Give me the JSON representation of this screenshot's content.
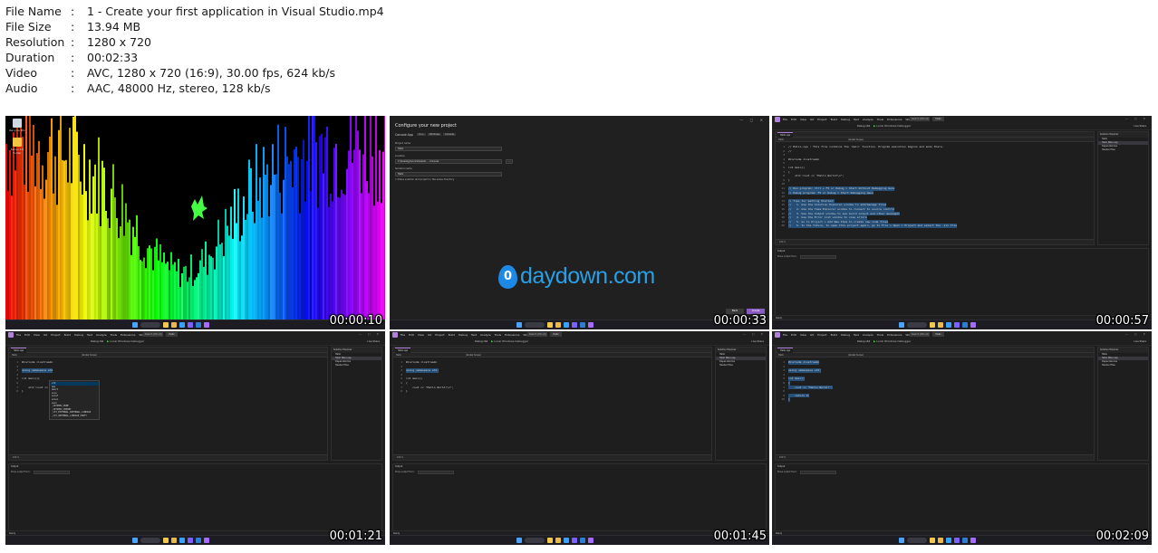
{
  "info": {
    "rows": [
      {
        "label": "File Name",
        "sep": ":",
        "value": "1 - Create your first application in Visual Studio.mp4"
      },
      {
        "label": "File Size",
        "sep": ":",
        "value": "13.94 MB"
      },
      {
        "label": "Resolution",
        "sep": ":",
        "value": "1280 x 720"
      },
      {
        "label": "Duration",
        "sep": ":",
        "value": "00:02:33"
      },
      {
        "label": "Video",
        "sep": ":",
        "value": "AVC, 1280 x 720 (16:9), 30.00 fps, 624 kb/s"
      },
      {
        "label": "Audio",
        "sep": ":",
        "value": "AAC, 48000 Hz, stereo, 128 kb/s"
      }
    ]
  },
  "thumbnails": [
    {
      "timestamp": "00:00:10",
      "desktop": {
        "icons": [
          {
            "label": "Recycle Bin",
            "icon": "recycle-bin-icon"
          },
          {
            "label": "Setup 1.0 Folder",
            "icon": "folder-icon"
          }
        ]
      }
    },
    {
      "timestamp": "00:00:33",
      "dialog": {
        "title": "Configure your new project",
        "project_type": "Console App",
        "tags": [
          "C++",
          "Windows",
          "Console"
        ],
        "fields": [
          {
            "label": "Project name",
            "value": "Hello"
          },
          {
            "label": "Location",
            "value": "C:\\Users\\jy\\source\\repos\\ ... Console"
          },
          {
            "label": "Solution name",
            "value": "Hello"
          }
        ],
        "checkbox": "Place solution and project in the same directory",
        "buttons": {
          "back": "Back",
          "create": "Create"
        },
        "watermark": {
          "badge": "0",
          "text": "daydown.com"
        }
      }
    },
    {
      "timestamp": "00:00:57",
      "ide": {
        "tab": "Hello.cpp",
        "code": [
          {
            "text": "// Hello.cpp : This file contains the 'main' function. Program execution begins and ends there.",
            "highlight": false
          },
          {
            "text": "//",
            "highlight": false
          },
          {
            "text": "",
            "highlight": false
          },
          {
            "text": "#include <iostream>",
            "highlight": false
          },
          {
            "text": "",
            "highlight": false
          },
          {
            "text": "int main()",
            "highlight": false
          },
          {
            "text": "{",
            "highlight": false
          },
          {
            "text": "    std::cout << \"Hello World!\\n\";",
            "highlight": false
          },
          {
            "text": "}",
            "highlight": false
          },
          {
            "text": "",
            "highlight": false
          },
          {
            "text": "// Run program: Ctrl + F5 or Debug > Start Without Debugging menu",
            "highlight": true
          },
          {
            "text": "// Debug program: F5 or Debug > Start Debugging menu",
            "highlight": true
          },
          {
            "text": "",
            "highlight": true
          },
          {
            "text": "// Tips for Getting Started:",
            "highlight": true
          },
          {
            "text": "//   1. Use the Solution Explorer window to add/manage files",
            "highlight": true
          },
          {
            "text": "//   2. Use the Team Explorer window to connect to source control",
            "highlight": true
          },
          {
            "text": "//   3. Use the Output window to see build output and other messages",
            "highlight": true
          },
          {
            "text": "//   4. Use the Error List window to view errors",
            "highlight": true
          },
          {
            "text": "//   5. Go to Project > Add New Item to create new code files",
            "highlight": true
          },
          {
            "text": "//   6. In the future, to open this project again, go to File > Open > Project and select the .sln file",
            "highlight": true
          }
        ],
        "solution_items": [
          "Hello",
          "Hello Main.cpp",
          "Dependencies",
          "Header Files"
        ],
        "autocomplete": []
      }
    },
    {
      "timestamp": "00:01:21",
      "ide": {
        "tab": "Hello.cpp",
        "code": [
          {
            "text": "#include <iostream>",
            "highlight": false
          },
          {
            "text": "",
            "highlight": false
          },
          {
            "text": "using namespace std",
            "highlight": true
          },
          {
            "text": "",
            "highlight": false
          },
          {
            "text": "int main(){",
            "highlight": false
          },
          {
            "text": "",
            "highlight": false
          },
          {
            "text": "    std::cout << \"",
            "highlight": false
          },
          {
            "text": "}",
            "highlight": false
          }
        ],
        "solution_items": [
          "Hello",
          "Hello Main.cpp",
          "Dependencies",
          "Header Files"
        ],
        "autocomplete": [
          "std",
          "abs",
          "abort",
          "acos",
          "acosf",
          "acosl",
          "asin",
          "_CRTIMP2_PURE",
          "_CRTIMP2_IMPORT",
          "_CST_EXTERNAL_INTERNAL_LINKAGE",
          "_CST_INTERNAL_LINKAGE_PARTY"
        ]
      }
    },
    {
      "timestamp": "00:01:45",
      "ide": {
        "tab": "Hello.cpp",
        "code": [
          {
            "text": "#include <iostream>",
            "highlight": false
          },
          {
            "text": "",
            "highlight": false
          },
          {
            "text": "using namespace std;",
            "highlight": true
          },
          {
            "text": "",
            "highlight": false
          },
          {
            "text": "int main()",
            "highlight": false
          },
          {
            "text": "{",
            "highlight": false
          },
          {
            "text": "    cout << \"Hello World!\\n\";",
            "highlight": false
          },
          {
            "text": "}",
            "highlight": false
          }
        ],
        "solution_items": [
          "Hello",
          "Hello Main.cpp",
          "Dependencies",
          "Header Files"
        ],
        "autocomplete": []
      }
    },
    {
      "timestamp": "00:02:09",
      "ide": {
        "tab": "Hello.cpp",
        "code": [
          {
            "text": "#include <iostream>",
            "highlight": true
          },
          {
            "text": "",
            "highlight": false
          },
          {
            "text": "using namespace std;",
            "highlight": true
          },
          {
            "text": "",
            "highlight": false
          },
          {
            "text": "int main()",
            "highlight": true
          },
          {
            "text": "{",
            "highlight": true
          },
          {
            "text": "    cout << \"Hello World!\";",
            "highlight": true
          },
          {
            "text": "",
            "highlight": false
          },
          {
            "text": "    return 0;",
            "highlight": true
          },
          {
            "text": "}",
            "highlight": true
          }
        ],
        "solution_items": [
          "Hello",
          "Hello Main.cpp",
          "Dependencies",
          "Header Files"
        ],
        "autocomplete": []
      }
    }
  ],
  "vs_chrome": {
    "menu": [
      "File",
      "Edit",
      "View",
      "Git",
      "Project",
      "Build",
      "Debug",
      "Test",
      "Analyze",
      "Tools",
      "Extensions",
      "Window",
      "Help"
    ],
    "search": "Search (Ctrl+Q)",
    "solution_name": "Hello",
    "config": "Debug",
    "platform": "x64",
    "run_target": "Local Windows Debugger",
    "live_share": "Live Share",
    "solution_explorer_title": "Solution Explorer",
    "output_title": "Output",
    "output_show_label": "Show output from:",
    "status_ready": "Ready",
    "nav_scope": "(Global Scope)"
  },
  "colors": {
    "vs_accent": "#b180d7",
    "selection": "#264f78",
    "watermark": "#29a0e6"
  }
}
